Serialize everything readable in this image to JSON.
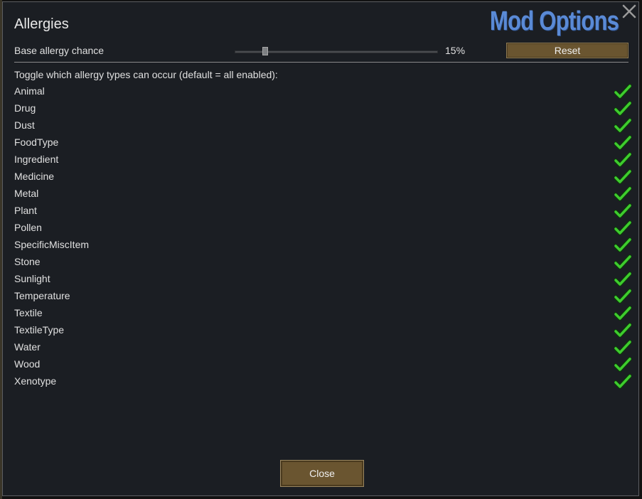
{
  "window": {
    "title": "Allergies",
    "mod_options_label": "Mod Options",
    "accent_color": "#5a8ad6"
  },
  "settings": {
    "base_chance_label": "Base allergy chance",
    "base_chance_value": "15%",
    "base_chance_fraction": 0.15,
    "reset_label": "Reset"
  },
  "toggles": {
    "heading": "Toggle which allergy types can occur (default = all enabled):",
    "check_color": "#3ecc2e",
    "items": [
      {
        "label": "Animal",
        "enabled": true
      },
      {
        "label": "Drug",
        "enabled": true
      },
      {
        "label": "Dust",
        "enabled": true
      },
      {
        "label": "FoodType",
        "enabled": true
      },
      {
        "label": "Ingredient",
        "enabled": true
      },
      {
        "label": "Medicine",
        "enabled": true
      },
      {
        "label": "Metal",
        "enabled": true
      },
      {
        "label": "Plant",
        "enabled": true
      },
      {
        "label": "Pollen",
        "enabled": true
      },
      {
        "label": "SpecificMiscItem",
        "enabled": true
      },
      {
        "label": "Stone",
        "enabled": true
      },
      {
        "label": "Sunlight",
        "enabled": true
      },
      {
        "label": "Temperature",
        "enabled": true
      },
      {
        "label": "Textile",
        "enabled": true
      },
      {
        "label": "TextileType",
        "enabled": true
      },
      {
        "label": "Water",
        "enabled": true
      },
      {
        "label": "Wood",
        "enabled": true
      },
      {
        "label": "Xenotype",
        "enabled": true
      }
    ]
  },
  "footer": {
    "close_label": "Close"
  }
}
